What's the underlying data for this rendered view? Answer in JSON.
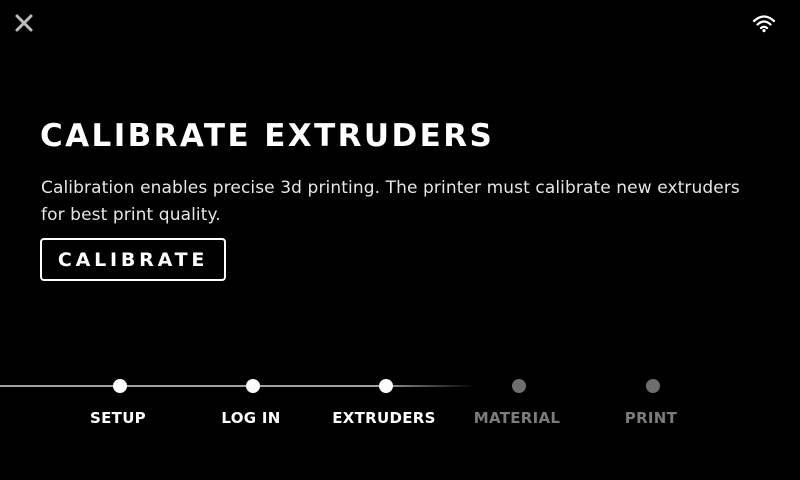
{
  "header": {
    "close_icon": "close-icon",
    "wifi_icon": "wifi-icon"
  },
  "main": {
    "title": "CALIBRATE EXTRUDERS",
    "description": "Calibration enables precise 3d printing. The printer must calibrate new extruders for best print quality.",
    "calibrate_label": "CALIBRATE"
  },
  "progress": {
    "current_step": 3,
    "steps": [
      {
        "label": "SETUP",
        "state": "done"
      },
      {
        "label": "LOG IN",
        "state": "done"
      },
      {
        "label": "EXTRUDERS",
        "state": "current"
      },
      {
        "label": "MATERIAL",
        "state": "todo"
      },
      {
        "label": "PRINT",
        "state": "todo"
      }
    ]
  },
  "colors": {
    "background": "#000000",
    "active": "#ffffff",
    "inactive": "#6e6e6e"
  }
}
